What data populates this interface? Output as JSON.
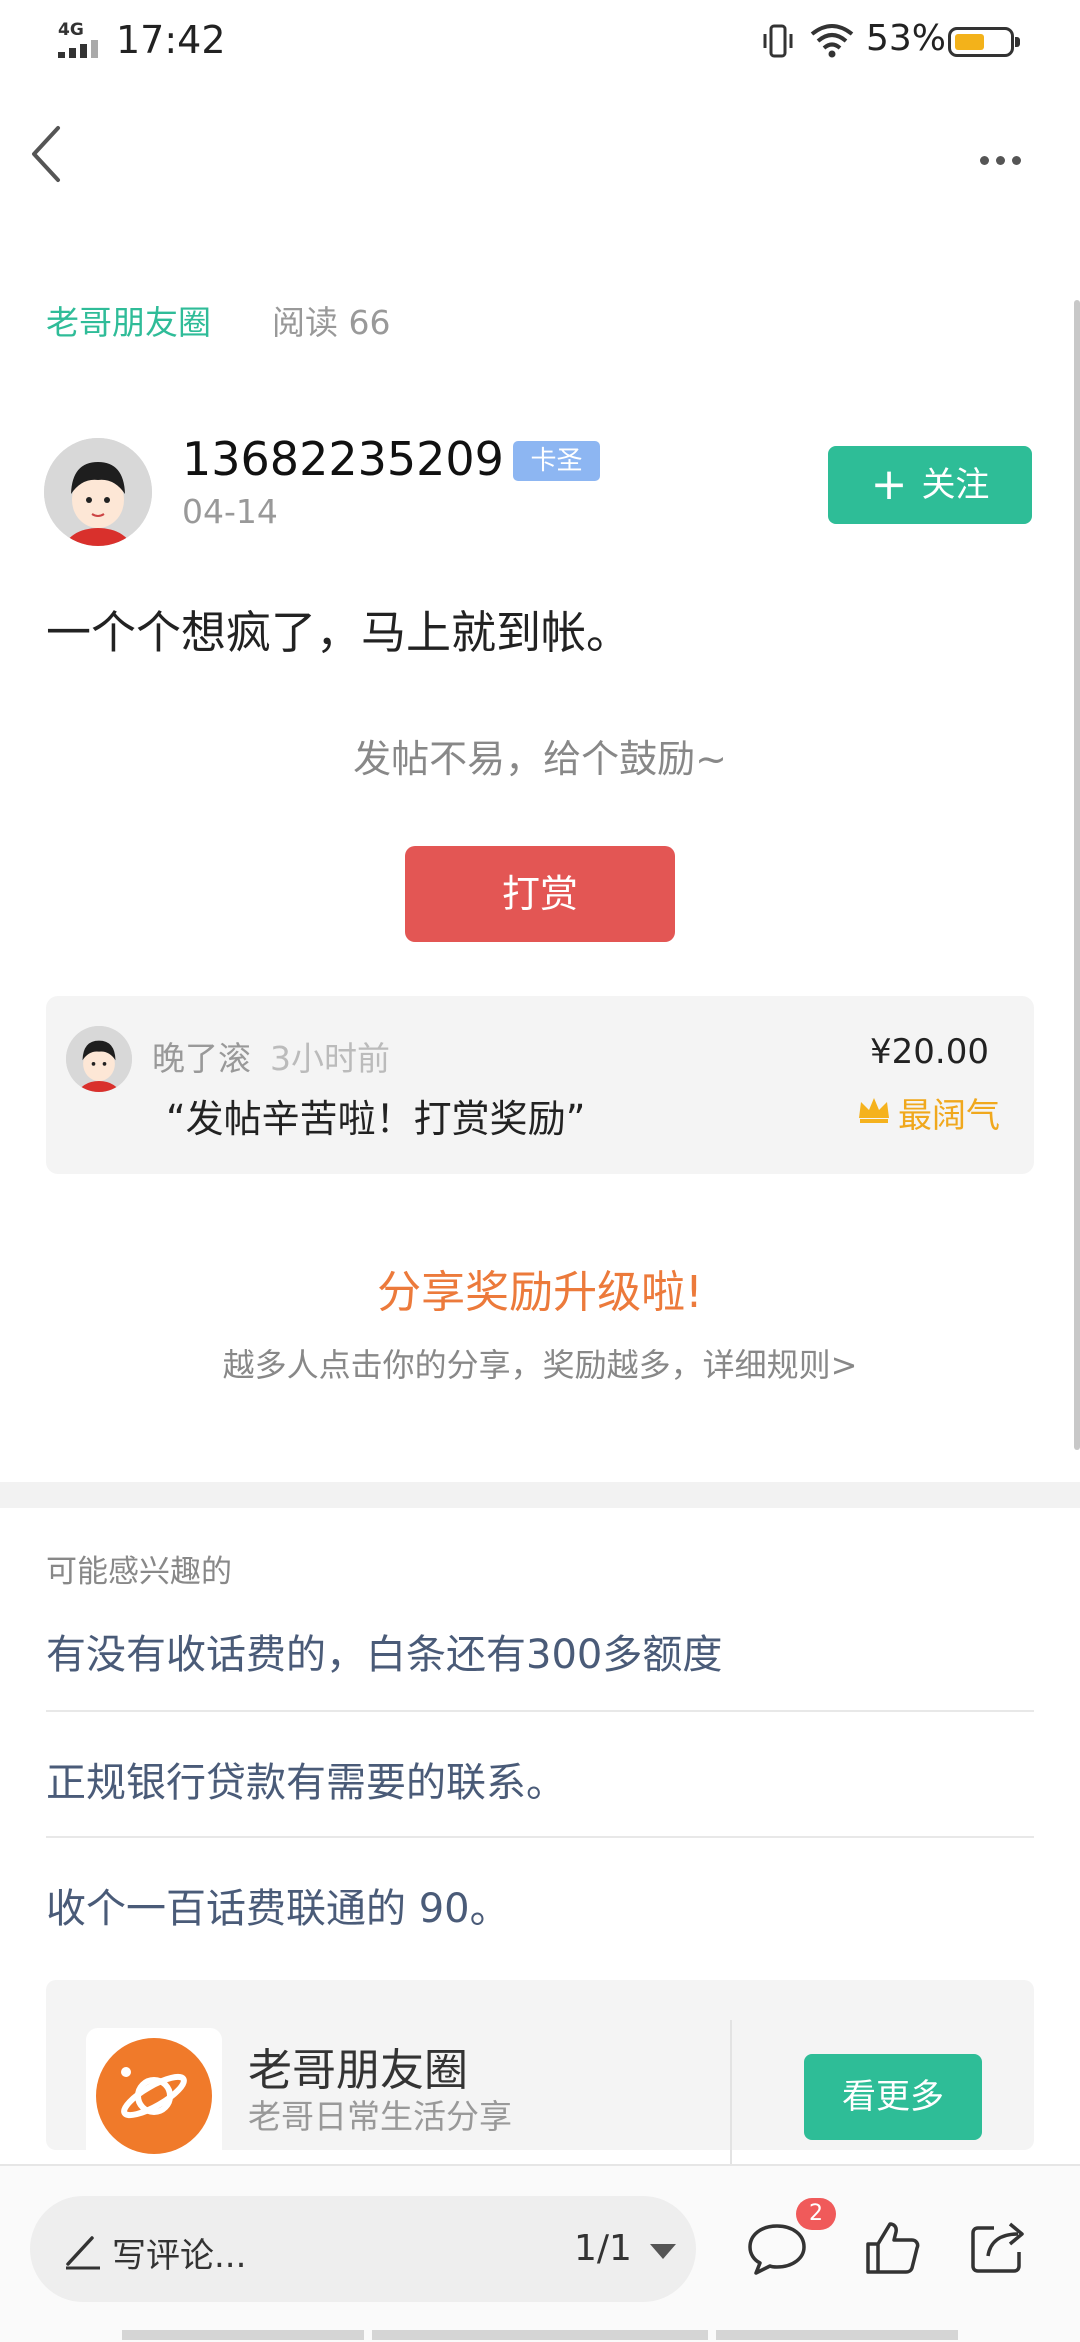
{
  "status_bar": {
    "network": "4G",
    "time": "17:42",
    "battery_percent": "53%",
    "battery_level": 0.53
  },
  "header": {
    "back_icon": "back-arrow-icon",
    "more_icon": "more-dots-icon"
  },
  "post": {
    "circle_name": "老哥朋友圈",
    "read_count": "阅读 66",
    "author": {
      "username": "13682235209",
      "badge": "卡圣",
      "date": "04-14"
    },
    "follow_label": "关注",
    "content": "一个个想疯了，马上就到帐。"
  },
  "reward": {
    "prompt": "发帖不易，给个鼓励~",
    "button_label": "打赏",
    "latest": {
      "user": "晚了滚",
      "time": "3小时前",
      "message": "“发帖辛苦啦！打赏奖励”",
      "amount": "¥20.00",
      "tag": "最阔气"
    }
  },
  "share": {
    "title": "分享奖励升级啦!",
    "subtitle": "越多人点击你的分享，奖励越多，详细规则>"
  },
  "interest": {
    "title": "可能感兴趣的",
    "items": [
      "有没有收话费的，白条还有300多额度",
      "正规银行贷款有需要的联系。",
      "收个一百话费联通的 90。"
    ]
  },
  "circle_card": {
    "name": "老哥朋友圈",
    "description": "老哥日常生活分享",
    "button_label": "看更多"
  },
  "bottom_bar": {
    "comment_placeholder": "写评论...",
    "page_indicator": "1/1",
    "comment_count": "2"
  },
  "colors": {
    "accent_green": "#2ebd97",
    "reward_red": "#e35654",
    "share_orange": "#ec7a3b",
    "gold": "#f0a81d",
    "link_blue": "#4a5b78"
  }
}
